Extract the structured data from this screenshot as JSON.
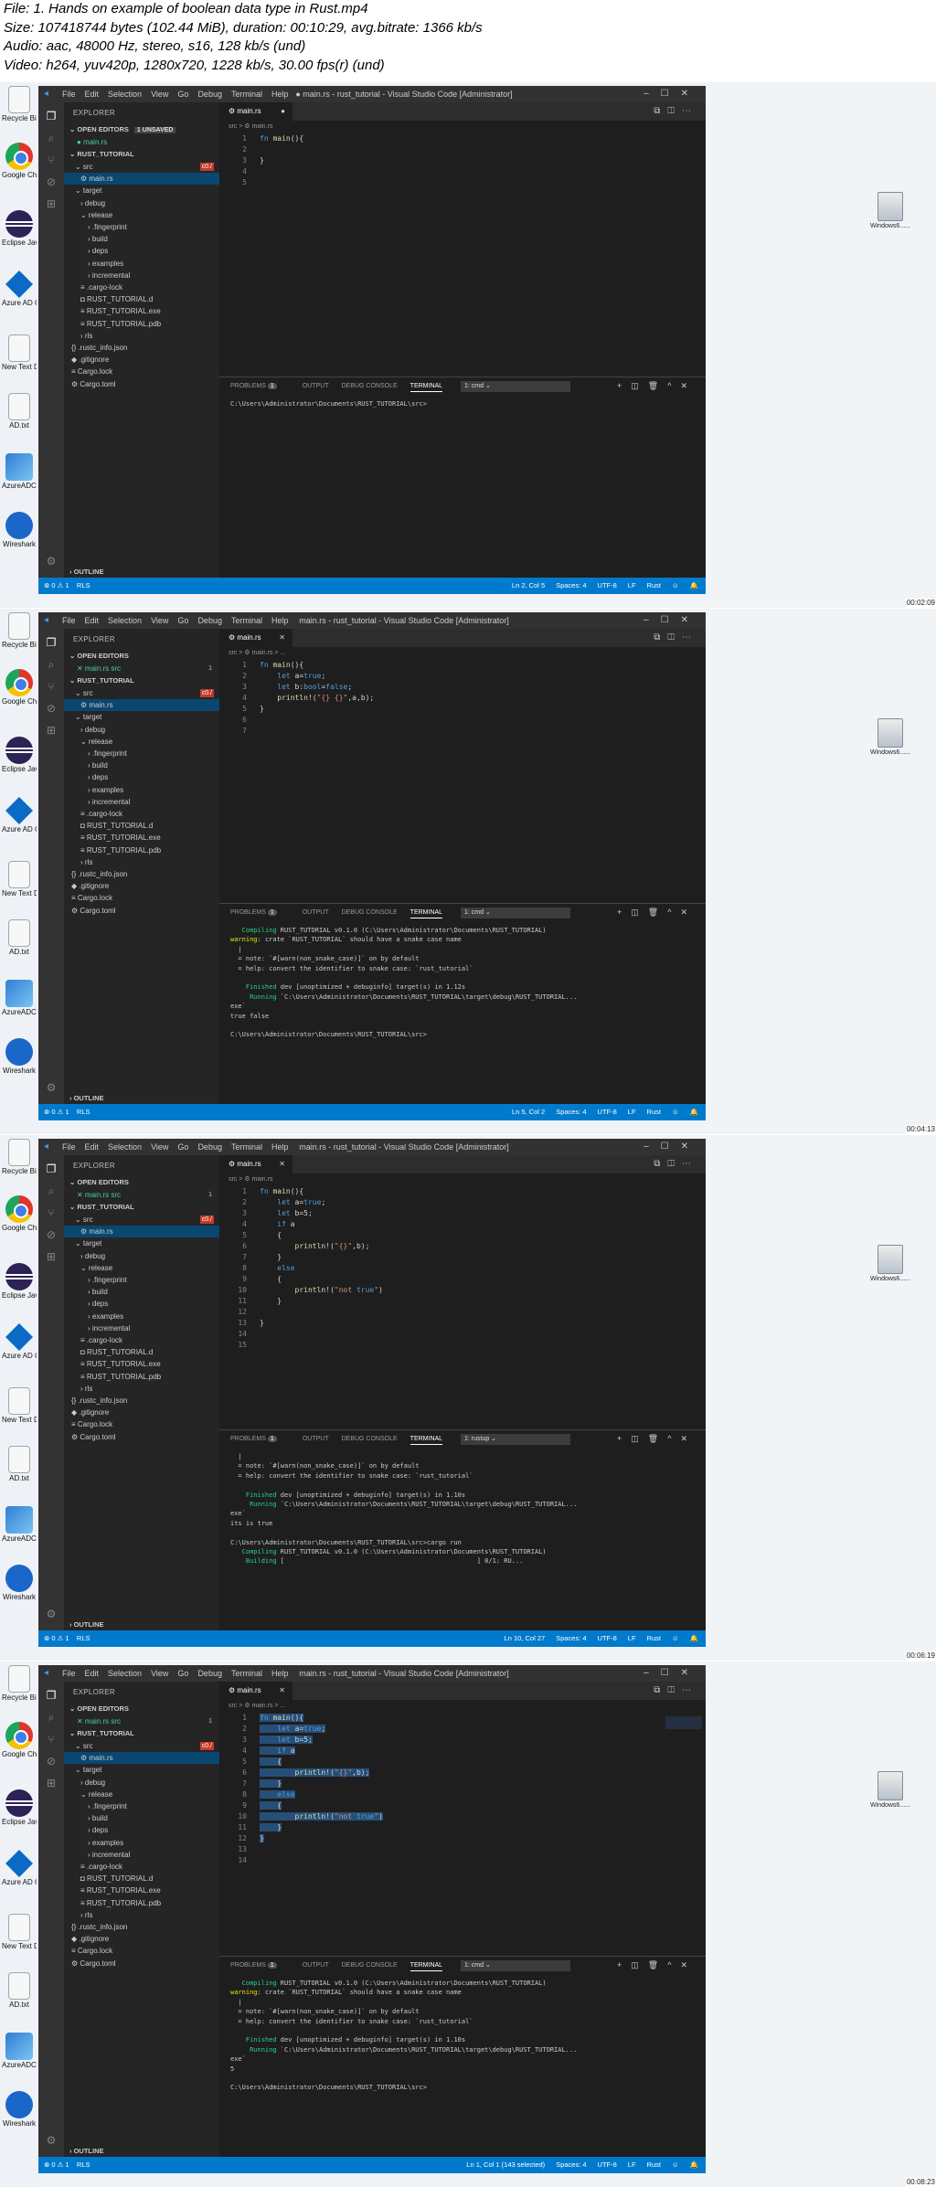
{
  "header": {
    "file": "File: 1. Hands on example of boolean data type in Rust.mp4",
    "size": "Size: 107418744 bytes (102.44 MiB), duration: 00:10:29, avg.bitrate: 1366 kb/s",
    "audio": "Audio: aac, 48000 Hz, stereo, s16, 128 kb/s (und)",
    "video": "Video: h264, yuv420p, 1280x720, 1228 kb/s, 30.00 fps(r) (und)"
  },
  "desktop": {
    "icons": [
      "Recycle Bin",
      "Google Chrome",
      "Eclipse Java 2019-03",
      "Azure AD Connect",
      "New Text Document.txt",
      "AD.txt",
      "AzureADCo...",
      "Wireshark"
    ],
    "remote_icon": "Windows6......"
  },
  "vscode": {
    "menu": [
      "File",
      "Edit",
      "Selection",
      "View",
      "Go",
      "Debug",
      "Terminal",
      "Help"
    ],
    "explorer_title": "EXPLORER",
    "open_editors": "OPEN EDITORS",
    "unsaved": "1 UNSAVED",
    "project": "RUST_TUTORIAL",
    "outline": "OUTLINE",
    "tree": [
      "src",
      "main.rs",
      "target",
      "debug",
      "release",
      ".fingerprint",
      "build",
      "deps",
      "examples",
      "incremental",
      ".cargo-lock",
      "RUST_TUTORIAL.d",
      "RUST_TUTORIAL.exe",
      "RUST_TUTORIAL.pdb",
      "rls",
      ".rustc_info.json",
      ".gitignore",
      "Cargo.lock",
      "Cargo.toml"
    ],
    "tab_file": "main.rs",
    "panel_tabs": [
      "PROBLEMS",
      "OUTPUT",
      "DEBUG CONSOLE",
      "TERMINAL"
    ],
    "problems_count": "1",
    "status_right": [
      "Spaces: 4",
      "UTF-8",
      "LF",
      "Rust"
    ],
    "status_left_errors": "⊗ 0 ⚠ 1",
    "status_rls": "RLS"
  },
  "frames": [
    {
      "title": "● main.rs - rust_tutorial - Visual Studio Code [Administrator]",
      "crumb": "src > ⚙ main.rs",
      "open_item": "● main.rs",
      "open_badge": "",
      "code": [
        "fn main(){",
        "    ",
        "}",
        "",
        ""
      ],
      "terminal_select": "1: cmd",
      "terminal": [
        "C:\\Users\\Administrator\\Documents\\RUST_TUTORIAL\\src>"
      ],
      "cursor": "Ln 2, Col 5",
      "stamp": "00:02:09"
    },
    {
      "title": "main.rs - rust_tutorial - Visual Studio Code [Administrator]",
      "crumb": "src > ⚙ main.rs > ...",
      "open_item": "✕ main.rs src",
      "open_badge": "1",
      "code": [
        "fn main(){",
        "    let a=true;",
        "    let b:bool=false;",
        "    println!(\"{} {}\",a,b);",
        "}",
        "",
        ""
      ],
      "terminal_select": "1: cmd",
      "terminal": [
        "   Compiling RUST_TUTORIAL v0.1.0 (C:\\Users\\Administrator\\Documents\\RUST_TUTORIAL)",
        "warning: crate `RUST_TUTORIAL` should have a snake case name",
        "  |",
        "  = note: `#[warn(non_snake_case)]` on by default",
        "  = help: convert the identifier to snake case: `rust_tutorial`",
        "",
        "    Finished dev [unoptimized + debuginfo] target(s) in 1.12s",
        "     Running `C:\\Users\\Administrator\\Documents\\RUST_TUTORIAL\\target\\debug\\RUST_TUTORIAL...",
        "exe`",
        "true false",
        "",
        "C:\\Users\\Administrator\\Documents\\RUST_TUTORIAL\\src>"
      ],
      "cursor": "Ln 5, Col 2",
      "stamp": "00:04:13"
    },
    {
      "title": "main.rs - rust_tutorial - Visual Studio Code [Administrator]",
      "crumb": "src > ⚙ main.rs",
      "open_item": "✕ main.rs src",
      "open_badge": "1",
      "code": [
        "fn main(){",
        "    let a=true;",
        "    let b=5;",
        "    if a",
        "    {",
        "        println!(\"{}\",b);",
        "    }",
        "    else",
        "    {",
        "        println!(\"not true\")",
        "    }",
        "",
        "}",
        "",
        ""
      ],
      "terminal_select": "1: rustup",
      "terminal": [
        "  |",
        "  = note: `#[warn(non_snake_case)]` on by default",
        "  = help: convert the identifier to snake case: `rust_tutorial`",
        "",
        "    Finished dev [unoptimized + debuginfo] target(s) in 1.10s",
        "     Running `C:\\Users\\Administrator\\Documents\\RUST_TUTORIAL\\target\\debug\\RUST_TUTORIAL...",
        "exe`",
        "its is true",
        "",
        "C:\\Users\\Administrator\\Documents\\RUST_TUTORIAL\\src>cargo run",
        "   Compiling RUST_TUTORIAL v0.1.0 (C:\\Users\\Administrator\\Documents\\RUST_TUTORIAL)",
        "    Building [                                                  ] 0/1: RU..."
      ],
      "cursor": "Ln 10, Col 27",
      "stamp": "00:06:19"
    },
    {
      "title": "main.rs - rust_tutorial - Visual Studio Code [Administrator]",
      "crumb": "src > ⚙ main.rs > ...",
      "open_item": "✕ main.rs src",
      "open_badge": "1",
      "code": [
        "fn main(){",
        "    let a=true;",
        "    let b=5;",
        "    if a",
        "    {",
        "        println!(\"{}\",b);",
        "    }",
        "    else",
        "    {",
        "        println!(\"not true\")",
        "    }",
        "}",
        "",
        ""
      ],
      "terminal_select": "1: cmd",
      "terminal": [
        "   Compiling RUST_TUTORIAL v0.1.0 (C:\\Users\\Administrator\\Documents\\RUST_TUTORIAL)",
        "warning: crate `RUST_TUTORIAL` should have a snake case name",
        "  |",
        "  = note: `#[warn(non_snake_case)]` on by default",
        "  = help: convert the identifier to snake case: `rust_tutorial`",
        "",
        "    Finished dev [unoptimized + debuginfo] target(s) in 1.10s",
        "     Running `C:\\Users\\Administrator\\Documents\\RUST_TUTORIAL\\target\\debug\\RUST_TUTORIAL...",
        "exe`",
        "5",
        "",
        "C:\\Users\\Administrator\\Documents\\RUST_TUTORIAL\\src>"
      ],
      "cursor": "Ln 1, Col 1 (143 selected)",
      "stamp": "00:08:23"
    }
  ]
}
